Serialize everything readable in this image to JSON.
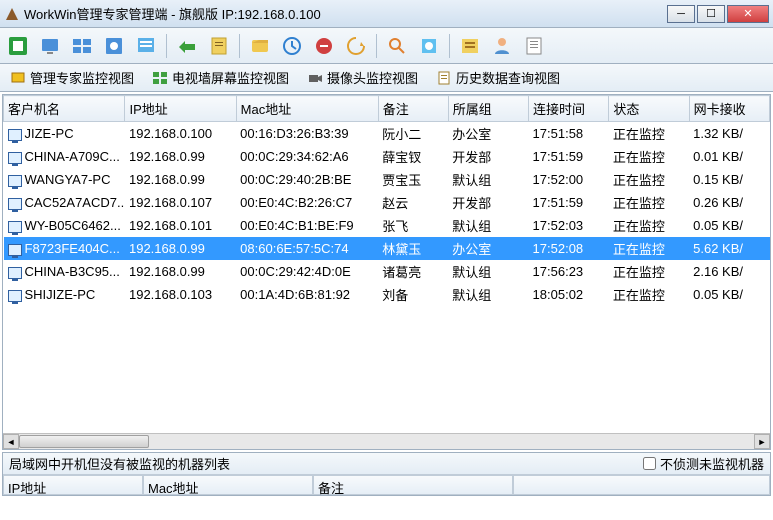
{
  "title": "WorkWin管理专家管理端 - 旗舰版 IP:192.168.0.100",
  "views": {
    "v1": "管理专家监控视图",
    "v2": "电视墙屏幕监控视图",
    "v3": "摄像头监控视图",
    "v4": "历史数据查询视图"
  },
  "columns": {
    "c0": "客户机名",
    "c1": "IP地址",
    "c2": "Mac地址",
    "c3": "备注",
    "c4": "所属组",
    "c5": "连接时间",
    "c6": "状态",
    "c7": "网卡接收"
  },
  "rows": [
    {
      "name": "JIZE-PC",
      "ip": "192.168.0.100",
      "mac": "00:16:D3:26:B3:39",
      "note": "阮小二",
      "group": "办公室",
      "time": "17:51:58",
      "status": "正在监控",
      "net": "1.32 KB/",
      "sel": false
    },
    {
      "name": "CHINA-A709C...",
      "ip": "192.168.0.99",
      "mac": "00:0C:29:34:62:A6",
      "note": "薛宝钗",
      "group": "开发部",
      "time": "17:51:59",
      "status": "正在监控",
      "net": "0.01 KB/",
      "sel": false
    },
    {
      "name": "WANGYA7-PC",
      "ip": "192.168.0.99",
      "mac": "00:0C:29:40:2B:BE",
      "note": "贾宝玉",
      "group": "默认组",
      "time": "17:52:00",
      "status": "正在监控",
      "net": "0.15 KB/",
      "sel": false
    },
    {
      "name": "CAC52A7ACD7...",
      "ip": "192.168.0.107",
      "mac": "00:E0:4C:B2:26:C7",
      "note": "赵云",
      "group": "开发部",
      "time": "17:51:59",
      "status": "正在监控",
      "net": "0.26 KB/",
      "sel": false
    },
    {
      "name": "WY-B05C6462...",
      "ip": "192.168.0.101",
      "mac": "00:E0:4C:B1:BE:F9",
      "note": "张飞",
      "group": "默认组",
      "time": "17:52:03",
      "status": "正在监控",
      "net": "0.05 KB/",
      "sel": false
    },
    {
      "name": "F8723FE404C...",
      "ip": "192.168.0.99",
      "mac": "08:60:6E:57:5C:74",
      "note": "林黛玉",
      "group": "办公室",
      "time": "17:52:08",
      "status": "正在监控",
      "net": "5.62 KB/",
      "sel": true
    },
    {
      "name": "CHINA-B3C95...",
      "ip": "192.168.0.99",
      "mac": "00:0C:29:42:4D:0E",
      "note": "诸葛亮",
      "group": "默认组",
      "time": "17:56:23",
      "status": "正在监控",
      "net": "2.16 KB/",
      "sel": false
    },
    {
      "name": "SHIJIZE-PC",
      "ip": "192.168.0.103",
      "mac": "00:1A:4D:6B:81:92",
      "note": "刘备",
      "group": "默认组",
      "time": "18:05:02",
      "status": "正在监控",
      "net": "0.05 KB/",
      "sel": false
    }
  ],
  "bottom": {
    "label": "局域网中开机但没有被监视的机器列表",
    "checkbox": "不侦测未监视机器",
    "cols": {
      "c1": "IP地址",
      "c2": "Mac地址",
      "c3": "备注"
    }
  }
}
